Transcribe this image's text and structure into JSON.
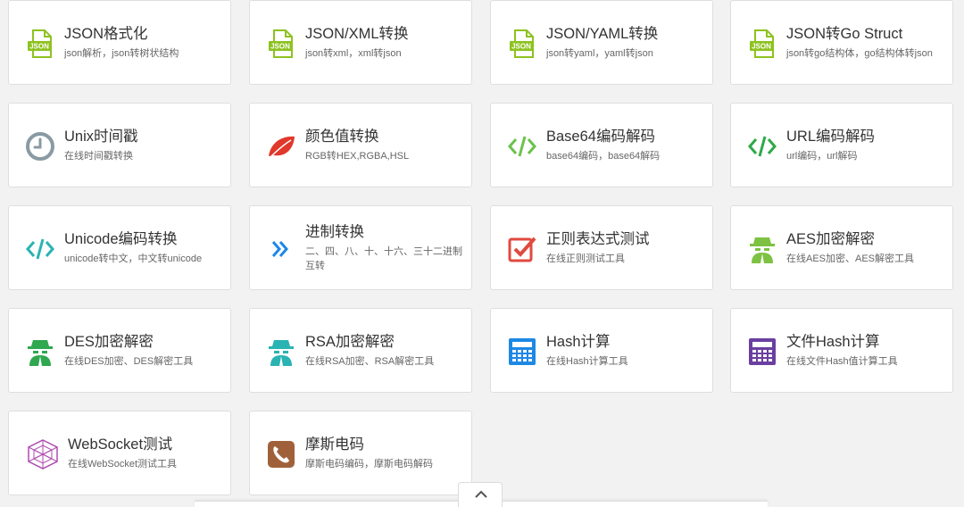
{
  "tools": [
    {
      "icon": "json-file-icon",
      "title": "JSON格式化",
      "desc": "json解析，json转树状结构"
    },
    {
      "icon": "json-file-icon",
      "title": "JSON/XML转换",
      "desc": "json转xml，xml转json"
    },
    {
      "icon": "json-file-icon",
      "title": "JSON/YAML转换",
      "desc": "json转yaml，yaml转json"
    },
    {
      "icon": "json-file-icon",
      "title": "JSON转Go Struct",
      "desc": "json转go结构体，go结构体转json"
    },
    {
      "icon": "clock-icon",
      "title": "Unix时间戳",
      "desc": "在线时间戳转换"
    },
    {
      "icon": "leaf-icon",
      "title": "颜色值转换",
      "desc": "RGB转HEX,RGBA,HSL"
    },
    {
      "icon": "code-icon",
      "title": "Base64编码解码",
      "desc": "base64编码，base64解码"
    },
    {
      "icon": "code-icon",
      "title": "URL编码解码",
      "desc": "url编码，url解码"
    },
    {
      "icon": "code-icon",
      "title": "Unicode编码转换",
      "desc": "unicode转中文，中文转unicode"
    },
    {
      "icon": "double-chevron-right-icon",
      "title": "进制转换",
      "desc": "二、四、八、十、十六、三十二进制互转"
    },
    {
      "icon": "checkbox-icon",
      "title": "正则表达式测试",
      "desc": "在线正则测试工具"
    },
    {
      "icon": "spy-icon",
      "title": "AES加密解密",
      "desc": "在线AES加密、AES解密工具"
    },
    {
      "icon": "spy-icon",
      "title": "DES加密解密",
      "desc": "在线DES加密、DES解密工具"
    },
    {
      "icon": "spy-icon",
      "title": "RSA加密解密",
      "desc": "在线RSA加密、RSA解密工具"
    },
    {
      "icon": "calculator-icon",
      "title": "Hash计算",
      "desc": "在线Hash计算工具"
    },
    {
      "icon": "calculator-icon",
      "title": "文件Hash计算",
      "desc": "在线文件Hash值计算工具"
    },
    {
      "icon": "websocket-icon",
      "title": "WebSocket测试",
      "desc": "在线WebSocket测试工具"
    },
    {
      "icon": "phone-icon",
      "title": "摩斯电码",
      "desc": "摩斯电码编码，摩斯电码解码"
    }
  ],
  "colors": {
    "json": "#8dc21f",
    "clock": "#8a9aa3",
    "leaf": "#e0382b",
    "base64": "#6cc24a",
    "url": "#2daa47",
    "unicode": "#2ab3b3",
    "chevrons": "#1e88e5",
    "checkbox": "#e04a3f",
    "aes": "#7dc242",
    "des": "#2fa84f",
    "rsa": "#2ab3b3",
    "hash": "#1e88e5",
    "filehash": "#6a3fa0",
    "websocket": "#b04ab0",
    "phone": "#a0613a"
  },
  "footer": {
    "collapse_icon": "chevron-up-icon"
  }
}
